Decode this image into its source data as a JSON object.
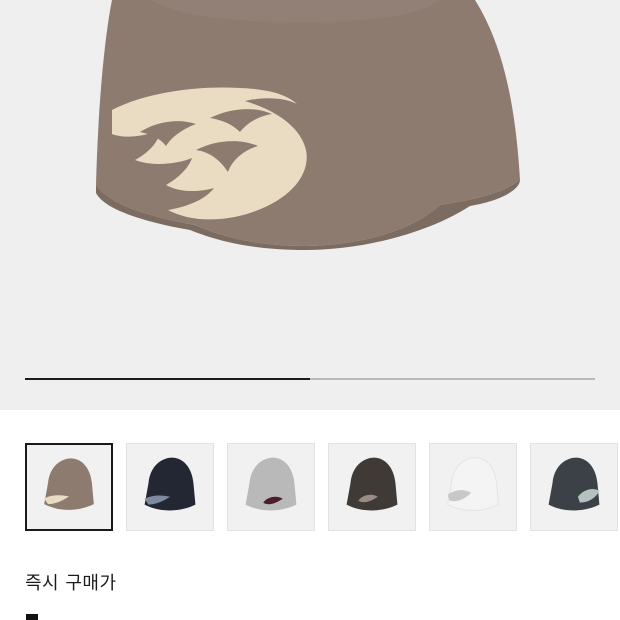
{
  "product": {
    "main_image_icon": "beanie-icon",
    "selected_index": 0,
    "gallery_progress": 0.5
  },
  "thumbnails": [
    {
      "name": "thumb-brown",
      "cap": "#8d7b70",
      "logo": "#e9dcc3"
    },
    {
      "name": "thumb-navy",
      "cap": "#222733",
      "logo": "#7c8aa0"
    },
    {
      "name": "thumb-grey",
      "cap": "#b9b9b9",
      "logo": "#4b1d2e"
    },
    {
      "name": "thumb-charcoal",
      "cap": "#3f3a36",
      "logo": "#9a8c85"
    },
    {
      "name": "thumb-white",
      "cap": "#f4f4f4",
      "logo": "#c8c8c8"
    },
    {
      "name": "thumb-dark-grey",
      "cap": "#3c4148",
      "logo": "#b5c1bf"
    }
  ],
  "buy": {
    "label": "즉시 구매가"
  }
}
